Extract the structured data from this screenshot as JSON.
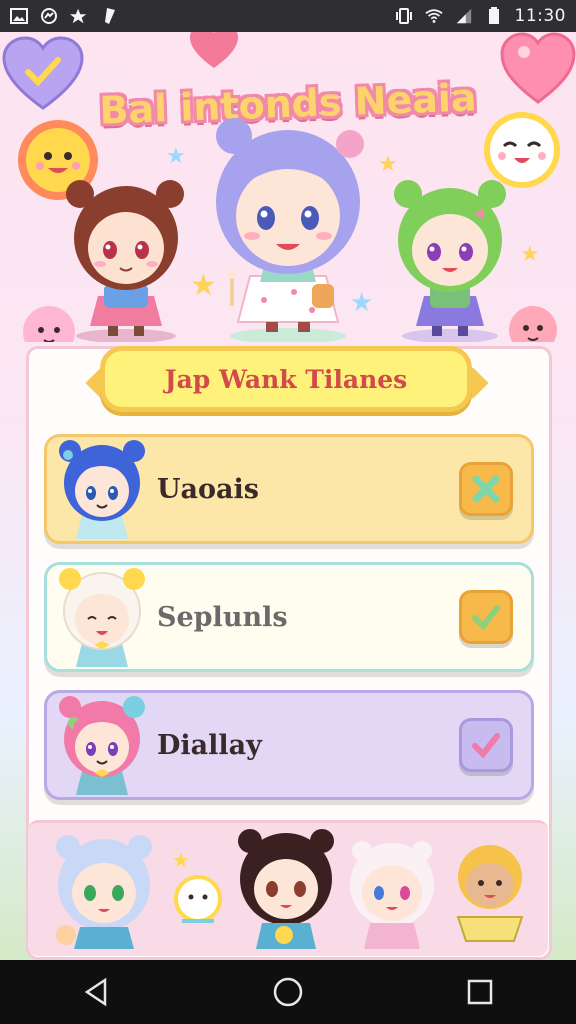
{
  "status_bar": {
    "time": "11:30",
    "left_icons": [
      "gallery-icon",
      "messenger-icon",
      "star-icon",
      "flashlight-icon"
    ],
    "right_icons": [
      "vibrate-icon",
      "wifi-icon",
      "signal-icon",
      "battery-icon"
    ]
  },
  "header": {
    "app_title": "Bal intonds Neaia"
  },
  "card": {
    "title": "Jap Wank Tilanes"
  },
  "items": [
    {
      "label": "Uaoais",
      "check_icon": "x-mark-icon",
      "color": "#fde7a8"
    },
    {
      "label": "Seplunls",
      "check_icon": "checkmark-icon",
      "color": "#fffdf0"
    },
    {
      "label": "Diallay",
      "check_icon": "checkmark-icon",
      "color": "#e2d8f6"
    }
  ],
  "nav_bar": {
    "buttons": [
      "back-icon",
      "home-icon",
      "recents-icon"
    ]
  },
  "colors": {
    "status_bar": "#2e2e33",
    "banner_fill": "#fff27a",
    "banner_border": "#f5c851",
    "title_text": "#d24a4a",
    "row1_border": "#f5c76a",
    "row2_border": "#a7dfdc",
    "row3_border": "#b9a8e6"
  }
}
